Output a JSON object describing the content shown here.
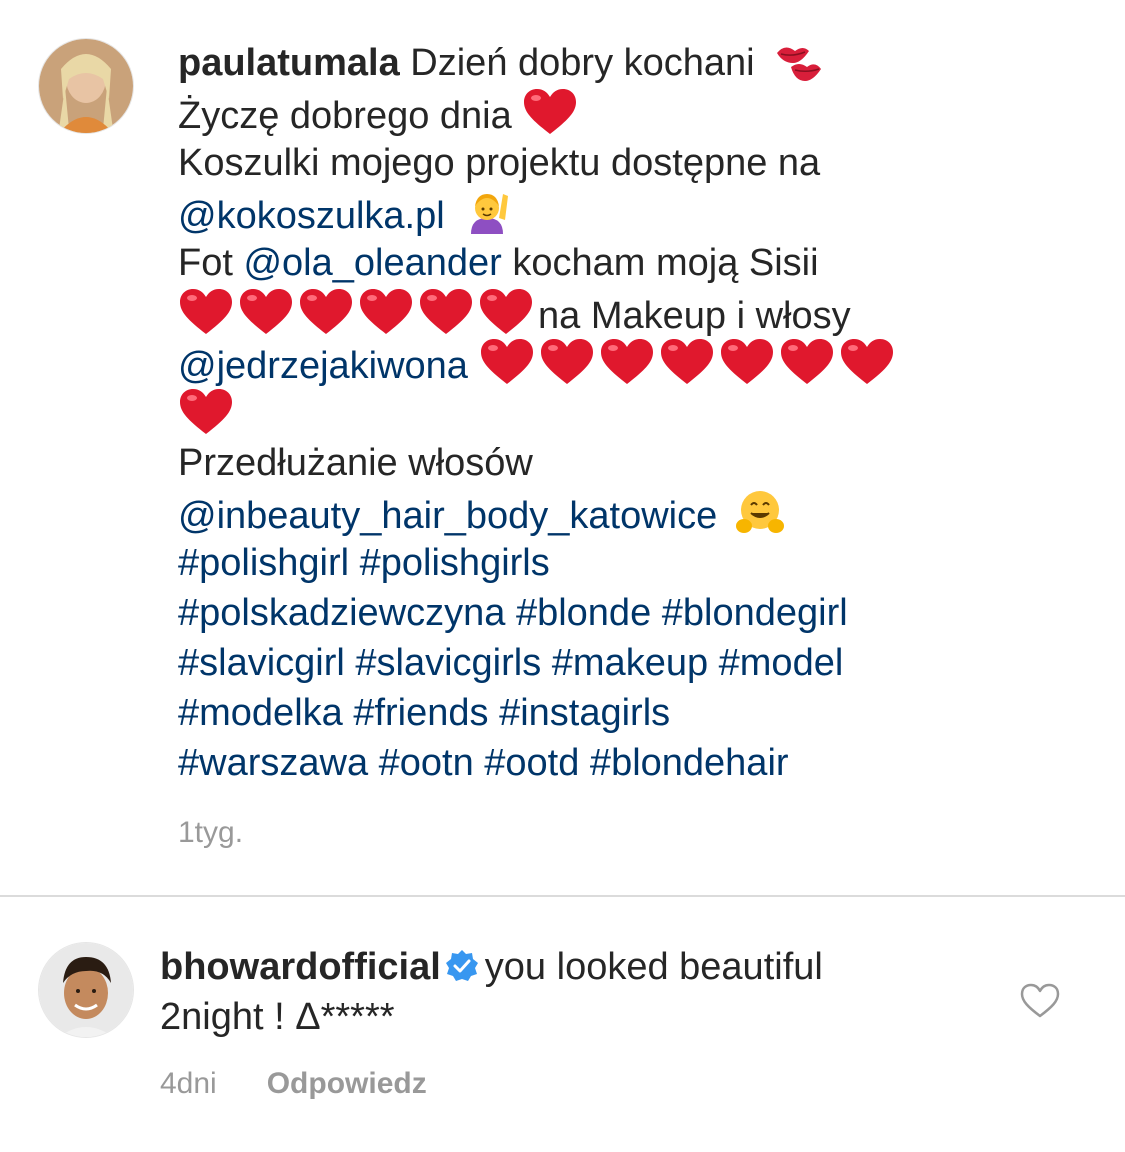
{
  "caption": {
    "username": "paulatumala",
    "lines": [
      [
        "Dzień dobry kochani"
      ],
      [
        "Życzę dobrego dnia"
      ],
      [
        "Koszulki mojego projektu dostępne na"
      ],
      [
        "@kokoszulka.pl"
      ],
      [
        "Fot ",
        "@ola_oleander",
        " kocham moją Sisii"
      ],
      [
        "na Makeup i włosy"
      ],
      [
        "@jedrzejakiwona"
      ],
      [
        "Przedłużanie włosów"
      ],
      [
        "@inbeauty_hair_body_katowice"
      ],
      [
        "#polishgirl #polishgirls"
      ],
      [
        "#polskadziewczyna #blonde #blondegirl"
      ],
      [
        "#slavicgirl #slavicgirls #makeup #model"
      ],
      [
        "#modelka #friends #instagirls"
      ],
      [
        "#warszawa #ootn #ootd #blondehair"
      ]
    ],
    "timestamp": "1tyg."
  },
  "reply": {
    "username": "bhowardofficial",
    "verified": true,
    "text_line1": "you looked beautiful",
    "text_line2": "2night ! Δ*****",
    "timestamp": "4dni",
    "reply_label": "Odpowiedz"
  },
  "icons": {
    "verified": "verified-badge-icon",
    "like": "heart-outline-icon",
    "emoji_heart": "red-heart-emoji",
    "emoji_kiss": "kiss-mark-emoji",
    "emoji_hand": "person-raising-hand-emoji",
    "emoji_hug": "hugging-face-emoji"
  },
  "colors": {
    "text": "#262626",
    "link": "#003569",
    "meta": "#999999",
    "verified": "#3897f0",
    "heart": "#e0182d",
    "divider": "#dbdbdb"
  }
}
